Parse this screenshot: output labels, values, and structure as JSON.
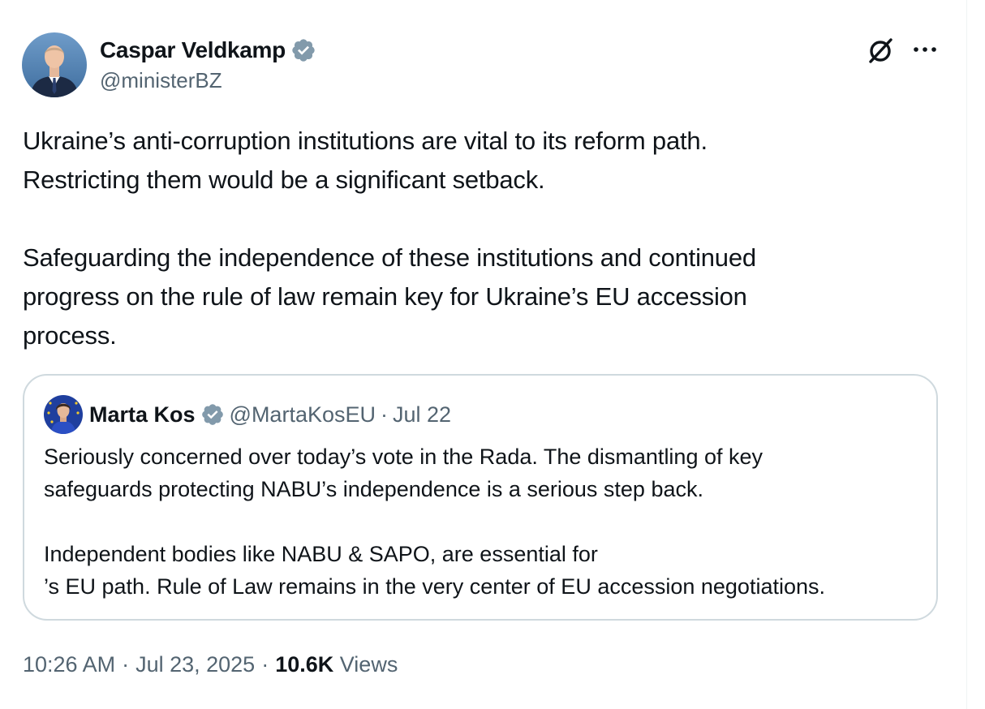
{
  "author": {
    "name": "Caspar Veldkamp",
    "handle": "@ministerBZ"
  },
  "post": {
    "paragraphs": [
      "Ukraine’s anti-corruption institutions are vital to its reform path.\nRestricting them would be a significant setback.",
      "Safeguarding the independence of these institutions and continued\nprogress on the rule of law remain key for Ukraine’s EU accession\nprocess."
    ]
  },
  "quote": {
    "name": "Marta Kos",
    "handle": "@MartaKosEU",
    "separator": "·",
    "date": "Jul 22",
    "paragraph1": "Seriously concerned over today’s vote in the Rada. The dismantling of key\nsafeguards protecting NABU’s independence is a serious step back.",
    "paragraph2_before_flag": "Independent bodies like NABU & SAPO, are essential for ",
    "flag_icon": "ukraine-flag-icon",
    "paragraph2_after_flag": "’s EU path. Rule of\nLaw remains in the very center of EU accession negotiations."
  },
  "meta": {
    "time": "10:26 AM",
    "sep1": "·",
    "date": "Jul 23, 2025",
    "sep2": "·",
    "views_count": "10.6K",
    "views_label": "Views"
  },
  "icons": {
    "verified": "verified-badge-icon",
    "grok": "grok-icon",
    "more": "more-options-icon"
  },
  "colors": {
    "text_primary": "#0f1419",
    "text_secondary": "#536471",
    "verified_badge": "#829aab",
    "border": "#cfd9de",
    "flag_blue": "#2f6fd0",
    "flag_yellow": "#f3cc2a"
  }
}
